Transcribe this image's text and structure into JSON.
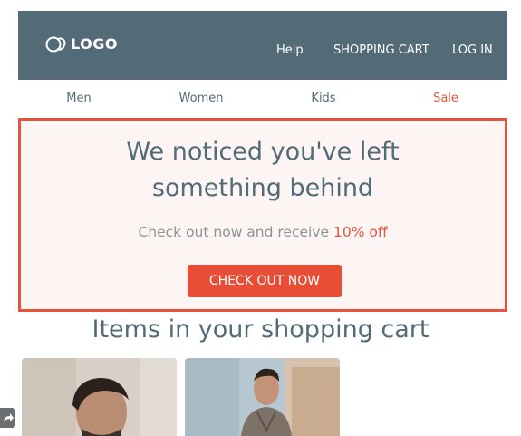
{
  "header": {
    "logo_text": "LOGO",
    "nav": [
      {
        "label": "Help"
      },
      {
        "label": "SHOPPING CART"
      },
      {
        "label": "LOG IN"
      }
    ]
  },
  "categories": [
    {
      "label": "Men"
    },
    {
      "label": "Women"
    },
    {
      "label": "Kids"
    },
    {
      "label": "Sale"
    }
  ],
  "banner": {
    "title_line1": "We noticed you've left",
    "title_line2": "something behind",
    "subtitle_prefix": "Check out now and receive",
    "subtitle_accent": "10% off",
    "cta_label": "CHECK OUT NOW"
  },
  "cart": {
    "title": "Items in your shopping cart"
  },
  "colors": {
    "header_bg": "#526b76",
    "accent": "#e5533d",
    "banner_bg": "#fdf5f3"
  },
  "icons": {
    "logo": "logo-icon",
    "side_arrow": "share-arrow-icon"
  }
}
